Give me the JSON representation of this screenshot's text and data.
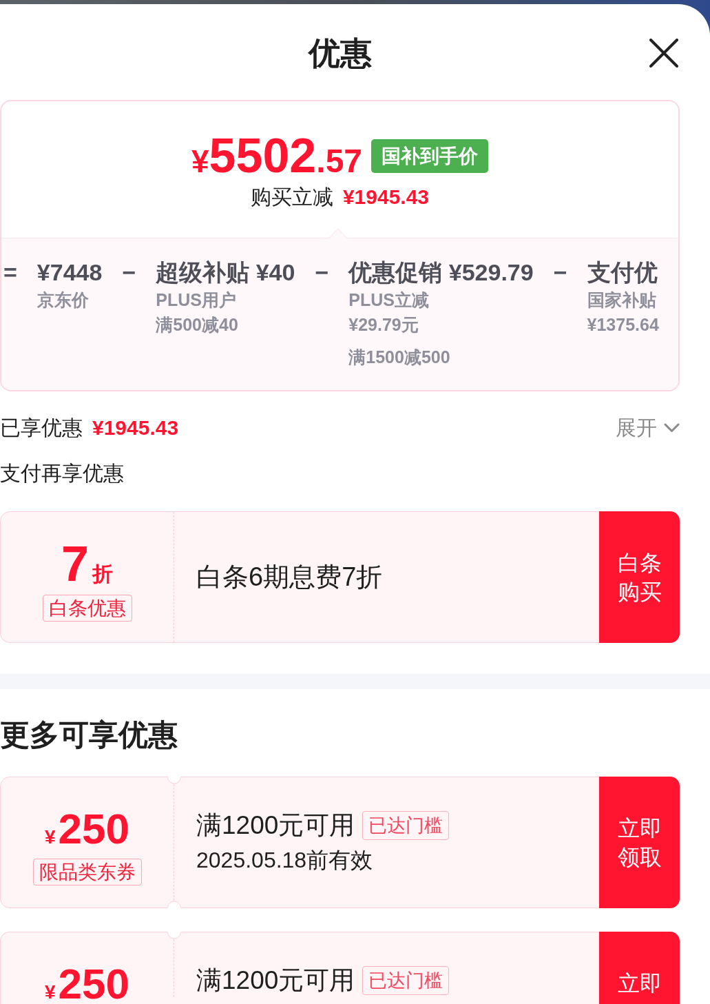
{
  "window": {
    "title": "优惠"
  },
  "price_card": {
    "final_price": {
      "currency": "¥",
      "whole": "5502",
      "fraction": ".57"
    },
    "badge": "国补到手价",
    "savings_label": "购买立减",
    "savings_amount": "¥1945.43",
    "breakdown": [
      {
        "operator": "=",
        "title": "¥7448",
        "note_groups": [
          [
            "京东价"
          ]
        ]
      },
      {
        "operator": "−",
        "title": "超级补贴 ¥40",
        "note_groups": [
          [
            "PLUS用户",
            "满500减40"
          ]
        ]
      },
      {
        "operator": "−",
        "title": "优惠促销 ¥529.79",
        "note_groups": [
          [
            "PLUS立减",
            "¥29.79元"
          ],
          [
            "满1500减500"
          ]
        ]
      },
      {
        "operator": "−",
        "title": "支付优",
        "note_groups": [
          [
            "国家补贴",
            "¥1375.64"
          ]
        ]
      }
    ]
  },
  "summary": {
    "label": "已享优惠",
    "amount": "¥1945.43",
    "toggle": {
      "label": "展开",
      "expanded": false
    }
  },
  "payment_offers": {
    "title": "支付再享优惠",
    "coupons": [
      {
        "kind": "discount",
        "value": "7",
        "unit": "折",
        "tag": "白条优惠",
        "title": "白条6期息费7折",
        "button": "白条购买"
      }
    ]
  },
  "more_offers": {
    "title": "更多可享优惠",
    "coupons": [
      {
        "kind": "voucher",
        "currency": "¥",
        "value": "250",
        "tag": "限品类东券",
        "title": "满1200元可用",
        "badge": "已达门槛",
        "validity": "2025.05.18前有效",
        "button": "立即领取"
      },
      {
        "kind": "voucher",
        "currency": "¥",
        "value": "250",
        "title": "满1200元可用",
        "badge": "已达门槛",
        "button": "立即"
      }
    ]
  }
}
